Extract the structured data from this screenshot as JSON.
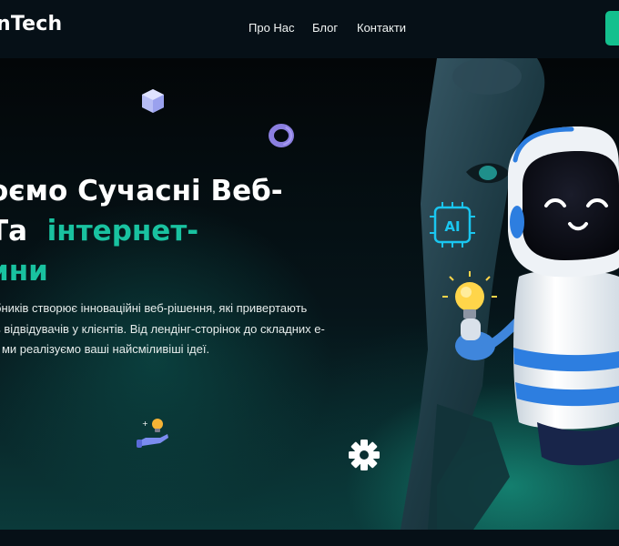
{
  "header": {
    "brand": "nTech",
    "nav": [
      {
        "label": "Про Нас"
      },
      {
        "label": "Блог"
      },
      {
        "label": "Контакти"
      }
    ]
  },
  "hero": {
    "title_line1": "оємо Сучасні Веб-",
    "title_line2_prefix": "Та ",
    "title_line2_accent": "інтернет-",
    "title_line3_accent": "ини",
    "desc_line1": "бників створює інноваційні веб-рішення, які привертають",
    "desc_line2": "ь відвідувачів у клієнтів. Від лендінг-сторінок до складних е-",
    "desc_line3": "- ми реалізуємо ваші найсміливіші ідеї."
  },
  "illustration": {
    "chip_label": "AI"
  },
  "colors": {
    "accent": "#19c2a0",
    "button": "#14c08e",
    "background": "#050b10"
  },
  "icons": [
    "cube-icon",
    "ring-icon",
    "lightbulb-hand-icon",
    "gear-icon",
    "ai-chip-icon",
    "lightbulb-icon"
  ]
}
